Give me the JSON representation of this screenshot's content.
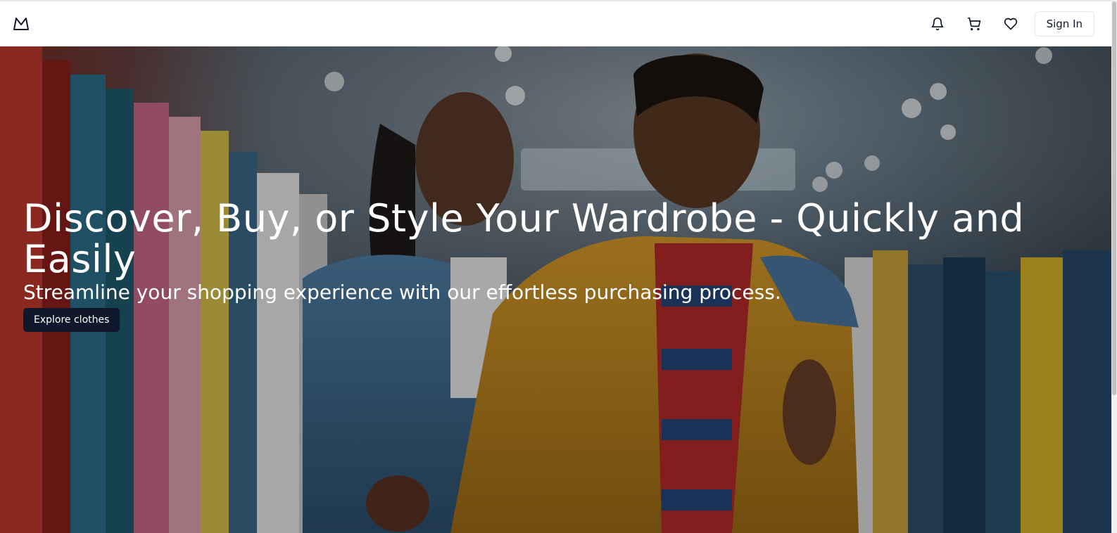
{
  "header": {
    "logo_icon": "mountain-logo-icon",
    "actions": {
      "notifications_icon": "bell-icon",
      "cart_icon": "shopping-cart-icon",
      "wishlist_icon": "heart-icon",
      "sign_in_label": "Sign In"
    }
  },
  "hero": {
    "title": "Discover, Buy, or Style Your Wardrobe - Quickly and Easily",
    "subtitle": "Streamline your shopping experience with our effortless purchasing process.",
    "cta_label": "Explore clothes",
    "image": "couple-in-clothing-store"
  },
  "colors": {
    "primary": "#0f172a",
    "header_bg": "#ffffff",
    "hero_text": "#ffffff",
    "border": "#e5e7eb"
  }
}
